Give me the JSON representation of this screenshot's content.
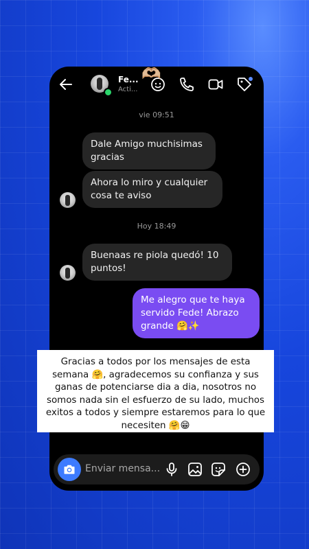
{
  "header": {
    "contact_name": "Fe...",
    "contact_status": "Acti...",
    "hearts_emoji": "🫶🏼"
  },
  "thread": {
    "timestamp_1": "vie 09:51",
    "msg_1": "Dale Amigo muchisimas gracias",
    "msg_2": "Ahora lo miro y cualquier cosa te aviso",
    "timestamp_2": "Hoy 18:49",
    "msg_3": "Buenaas re piola quedó! 10 puntos!",
    "msg_4": "Me alegro que te haya servido Fede! Abrazo grande 🤗✨"
  },
  "caption": {
    "text": "Gracias a todos por los mensajes de esta semana 🤗, agradecemos su confianza y sus ganas de potenciarse dia a dia, nosotros no somos nada sin el esfuerzo de su lado, muchos exitos a todos y siempre estaremos para lo que necesiten 🤗😁"
  },
  "composer": {
    "placeholder": "Enviar mensa..."
  },
  "icons": [
    "back-arrow-icon",
    "ai-sparkle-icon",
    "phone-icon",
    "video-icon",
    "tag-icon",
    "camera-icon",
    "microphone-icon",
    "gallery-icon",
    "sticker-icon",
    "plus-icon"
  ],
  "colors": {
    "background": "#1746dd",
    "outgoing_bubble": "#7a4cf2",
    "incoming_bubble": "#262626",
    "camera_button": "#3d7bff",
    "online_dot": "#2bd46a"
  }
}
